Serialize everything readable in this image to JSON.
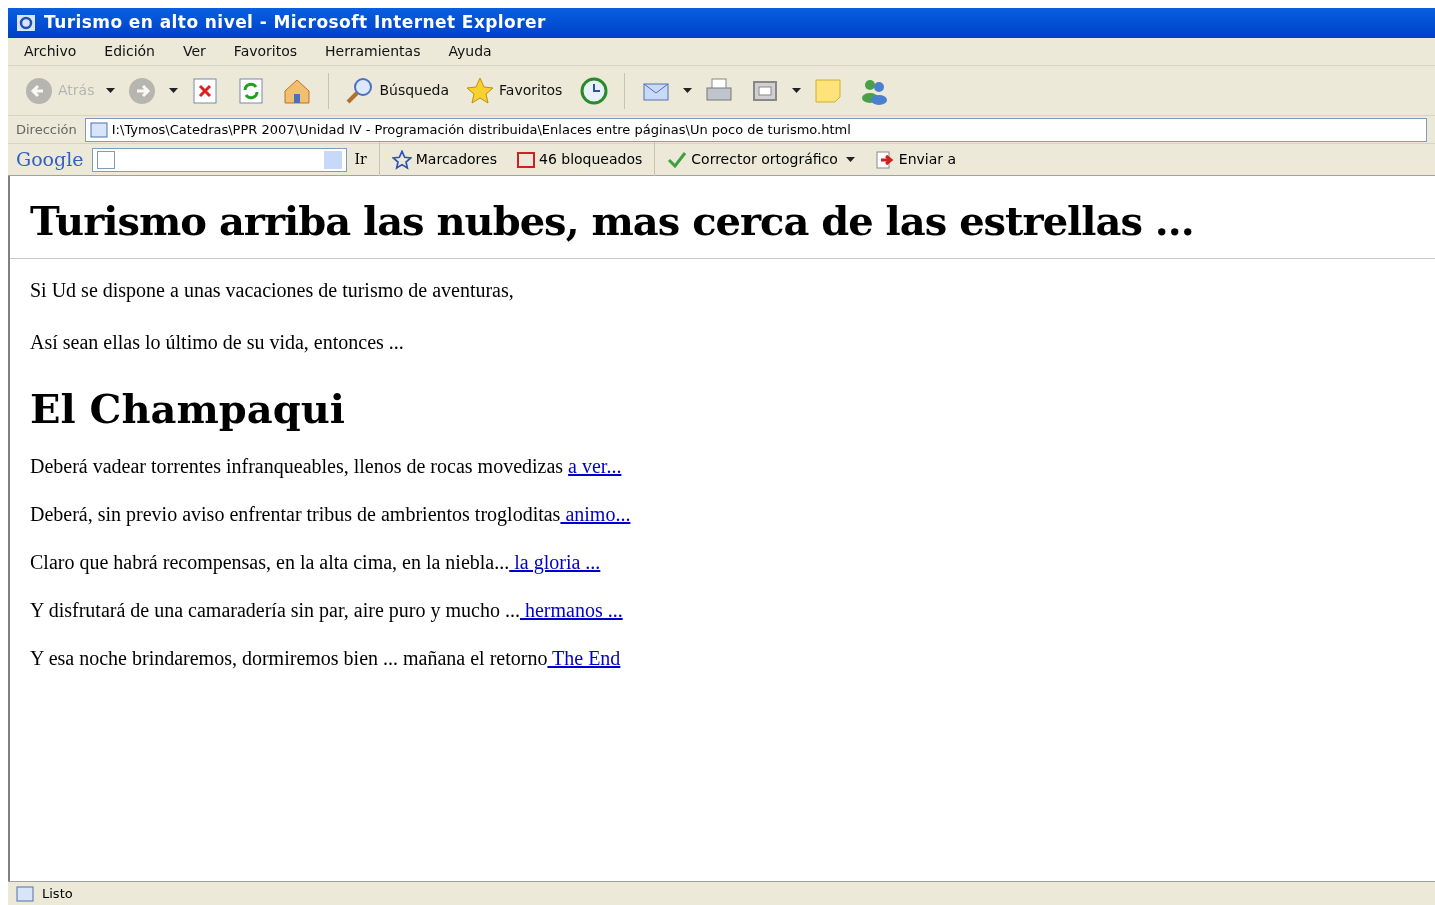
{
  "window": {
    "title": "Turismo en alto nivel - Microsoft Internet Explorer"
  },
  "menu": [
    "Archivo",
    "Edición",
    "Ver",
    "Favoritos",
    "Herramientas",
    "Ayuda"
  ],
  "toolbar": [
    {
      "kind": "back",
      "label": "Atrás",
      "disabled": true
    },
    {
      "kind": "forward",
      "disabled": true
    },
    {
      "kind": "stop",
      "disabled": false
    },
    {
      "kind": "refresh",
      "disabled": false
    },
    {
      "kind": "home",
      "disabled": false
    },
    {
      "kind": "search",
      "label": "Búsqueda",
      "disabled": false
    },
    {
      "kind": "favorites",
      "label": "Favoritos",
      "disabled": false
    },
    {
      "kind": "history",
      "disabled": false
    },
    {
      "kind": "mail",
      "disabled": false
    },
    {
      "kind": "print",
      "disabled": false
    },
    {
      "kind": "window",
      "disabled": false
    },
    {
      "kind": "note",
      "disabled": false
    },
    {
      "kind": "people",
      "disabled": false
    }
  ],
  "address": {
    "label": "Dirección",
    "value": "I:\\Tymos\\Catedras\\PPR 2007\\Unidad IV - Programación distribuida\\Enlaces entre páginas\\Un poco de turismo.html"
  },
  "google_bar": {
    "logo": "Google",
    "go": "Ir",
    "bookmarks": "Marcadores",
    "blocked": "46 bloqueados",
    "spell": "Corrector ortográfico",
    "send": "Enviar a"
  },
  "page": {
    "heading": "Turismo arriba las nubes, mas cerca de las estrellas ...",
    "intro": [
      "Si Ud se dispone a unas vacaciones de turismo de aventuras,",
      "Así sean ellas lo último de su vida, entonces ..."
    ],
    "section_heading": "El Champaqui",
    "lines": [
      {
        "text": "Deberá vadear torrentes infranqueables, llenos de rocas movedizas ",
        "link": "a ver..."
      },
      {
        "text": "Deberá, sin previo aviso enfrentar tribus de ambrientos trogloditas",
        "link": " animo..."
      },
      {
        "text": "Claro que habrá recompensas, en la alta cima, en la niebla...",
        "link": " la gloria ..."
      },
      {
        "text": "Y disfrutará de una camaradería sin par, aire puro y mucho ...",
        "link": " hermanos ..."
      },
      {
        "text": "Y esa noche brindaremos, dormiremos bien ... mañana el retorno",
        "link": " The End"
      }
    ]
  },
  "status_bar": {
    "text": "Listo"
  }
}
